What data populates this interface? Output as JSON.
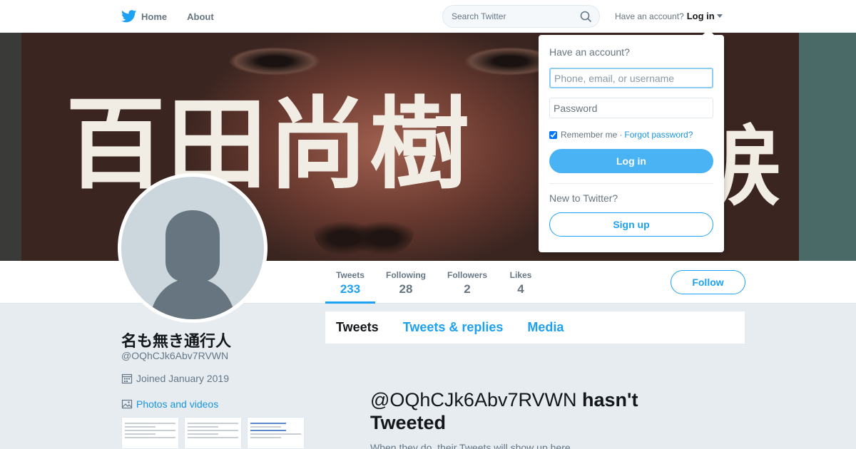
{
  "nav": {
    "home_label": "Home",
    "about_label": "About",
    "search_placeholder": "Search Twitter",
    "have_account": "Have an account?",
    "login_label": "Log in"
  },
  "banner": {
    "text": "百田尚樹",
    "text_partial": "涙"
  },
  "profile": {
    "name": "名も無き通行人",
    "handle": "@OQhCJk6Abv7RVWN",
    "joined": "Joined January 2019",
    "photos_label": "Photos and videos",
    "follow_label": "Follow"
  },
  "stats": [
    {
      "label": "Tweets",
      "value": "233",
      "active": true
    },
    {
      "label": "Following",
      "value": "28"
    },
    {
      "label": "Followers",
      "value": "2"
    },
    {
      "label": "Likes",
      "value": "4"
    }
  ],
  "tabs": [
    {
      "label": "Tweets",
      "active": true
    },
    {
      "label": "Tweets & replies"
    },
    {
      "label": "Media"
    }
  ],
  "empty": {
    "handle": "@OQhCJk6Abv7RVWN",
    "title_rest": " hasn't Tweeted",
    "subtitle": "When they do, their Tweets will show up here."
  },
  "login_dropdown": {
    "heading": "Have an account?",
    "user_placeholder": "Phone, email, or username",
    "password_placeholder": "Password",
    "remember": "Remember me",
    "separator": "·",
    "forgot": "Forgot password?",
    "login_button": "Log in",
    "new_to": "New to Twitter?",
    "signup_button": "Sign up",
    "remember_checked": true
  },
  "colors": {
    "accent": "#1da1f2",
    "background": "#e6ecf0",
    "login_button": "#4ab3f4"
  },
  "icons": [
    "twitter-bird-icon",
    "search-icon",
    "calendar-icon",
    "photo-icon",
    "caret-down-icon"
  ]
}
